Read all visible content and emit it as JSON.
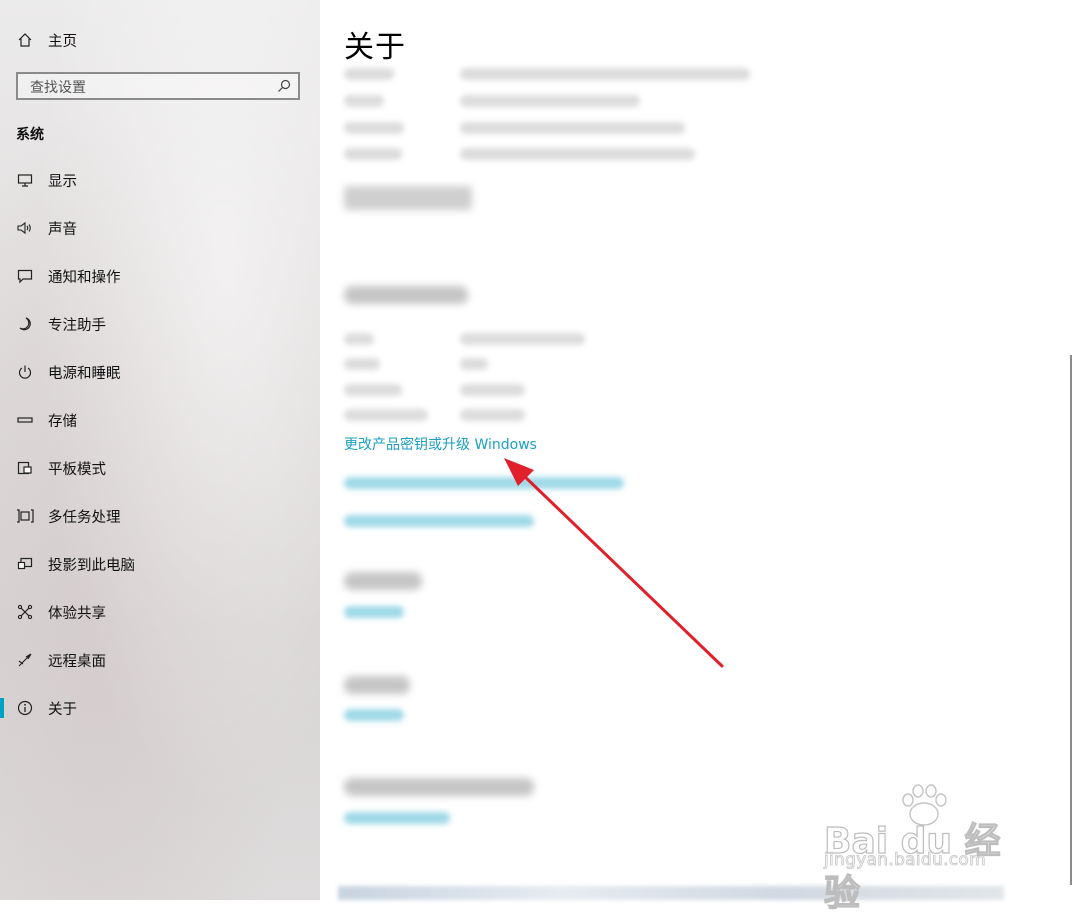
{
  "sidebar": {
    "home_label": "主页",
    "search_placeholder": "查找设置",
    "section_title": "系统",
    "items": [
      {
        "label": "显示",
        "icon": "monitor-icon"
      },
      {
        "label": "声音",
        "icon": "speaker-icon"
      },
      {
        "label": "通知和操作",
        "icon": "notification-icon"
      },
      {
        "label": "专注助手",
        "icon": "moon-icon"
      },
      {
        "label": "电源和睡眠",
        "icon": "power-icon"
      },
      {
        "label": "存储",
        "icon": "storage-icon"
      },
      {
        "label": "平板模式",
        "icon": "tablet-mode-icon"
      },
      {
        "label": "多任务处理",
        "icon": "multitasking-icon"
      },
      {
        "label": "投影到此电脑",
        "icon": "projection-icon"
      },
      {
        "label": "体验共享",
        "icon": "shared-experiences-icon"
      },
      {
        "label": "远程桌面",
        "icon": "remote-desktop-icon"
      },
      {
        "label": "关于",
        "icon": "info-icon",
        "active": true
      }
    ]
  },
  "main": {
    "title": "关于",
    "product_key_link": "更改产品密钥或升级 Windows"
  },
  "watermark": {
    "brand": "Bai du 经验",
    "url": "jingyan.baidu.com"
  },
  "colors": {
    "accent": "#00a1c7",
    "link": "#1a9fc0",
    "arrow": "#e0202a"
  }
}
